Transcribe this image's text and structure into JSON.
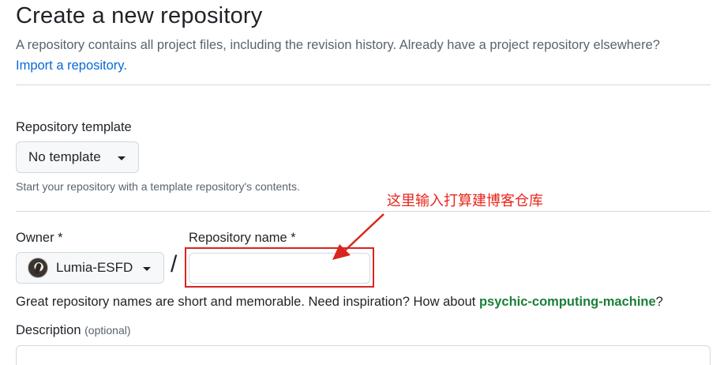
{
  "header": {
    "title": "Create a new repository",
    "subtitle": "A repository contains all project files, including the revision history. Already have a project repository elsewhere?",
    "import_link": "Import a repository."
  },
  "template": {
    "label": "Repository template",
    "selected": "No template",
    "helper": "Start your repository with a template repository's contents."
  },
  "owner": {
    "label": "Owner *",
    "selected": "Lumia-ESFD",
    "avatar_icon": "owner-avatar"
  },
  "separator": "/",
  "repo_name": {
    "label": "Repository name *",
    "value": "",
    "placeholder": ""
  },
  "annotation": {
    "text": "这里输入打算建博客仓库",
    "color": "#e8261c"
  },
  "inspiration": {
    "prefix": "Great repository names are short and memorable. Need inspiration? How about ",
    "suggestion": "psychic-computing-machine",
    "suffix": "?"
  },
  "description": {
    "label": "Description",
    "optional": "(optional)"
  },
  "colors": {
    "link": "#0969da",
    "suggestion": "#1a7f37",
    "annotation_red": "#d9251d"
  }
}
